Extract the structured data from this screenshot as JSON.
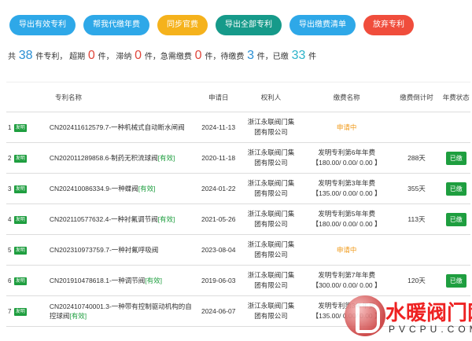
{
  "toolbar": {
    "export_valid": "导出有效专利",
    "pay_annual": "帮我代缴年费",
    "sync_official": "同步官费",
    "export_all": "导出全部专利",
    "export_fees": "导出缴费清单",
    "abandon": "放弃专利"
  },
  "summary": {
    "prefix": "共",
    "total": "38",
    "t1": "件专利，  超期",
    "overdue": "0",
    "t2": "件，  滞纳",
    "late": "0",
    "t3": "件，急需缴费",
    "urgent": "0",
    "t4": "件，待缴费",
    "pending": "3",
    "t5": "件，已缴",
    "paid": "33",
    "t6": "件"
  },
  "table": {
    "headers": {
      "name": "专利名称",
      "date": "申请日",
      "owner": "权利人",
      "fee": "缴费名称",
      "countdown": "缴费倒计时",
      "status": "年费状态"
    },
    "rows": [
      {
        "idx": "1",
        "tag": "发明",
        "name": "CN202411612579.7-一种机械式自动断水闸阀",
        "valid": "",
        "date": "2024-11-13",
        "owner1": "浙江永联阀门集",
        "owner2": "团有限公司",
        "fee1": "申请中",
        "fee2": "",
        "days": "",
        "status": ""
      },
      {
        "idx": "2",
        "tag": "发明",
        "name": "CN202011289858.6-制药无积流球阀",
        "valid": "[有效]",
        "date": "2020-11-18",
        "owner1": "浙江永联阀门集",
        "owner2": "团有限公司",
        "fee1": "发明专利第6年年费",
        "fee2": "【180.00/ 0.00/ 0.00 】",
        "days": "288天",
        "status": "已缴"
      },
      {
        "idx": "3",
        "tag": "发明",
        "name": "CN202410086334.9-一种蝶阀",
        "valid": "[有效]",
        "date": "2024-01-22",
        "owner1": "浙江永联阀门集",
        "owner2": "团有限公司",
        "fee1": "发明专利第3年年费",
        "fee2": "【135.00/ 0.00/ 0.00 】",
        "days": "355天",
        "status": "已缴"
      },
      {
        "idx": "4",
        "tag": "发明",
        "name": "CN202110577632.4-一种衬氟调节阀",
        "valid": "[有效]",
        "date": "2021-05-26",
        "owner1": "浙江永联阀门集",
        "owner2": "团有限公司",
        "fee1": "发明专利第5年年费",
        "fee2": "【180.00/ 0.00/ 0.00 】",
        "days": "113天",
        "status": "已缴"
      },
      {
        "idx": "5",
        "tag": "发明",
        "name": "CN202310973759.7-一种衬氟呼吸阀",
        "valid": "",
        "date": "2023-08-04",
        "owner1": "浙江永联阀门集",
        "owner2": "团有限公司",
        "fee1": "申请中",
        "fee2": "",
        "days": "",
        "status": ""
      },
      {
        "idx": "6",
        "tag": "发明",
        "name": "CN201910478618.1-一种调节阀",
        "valid": "[有效]",
        "date": "2019-06-03",
        "owner1": "浙江永联阀门集",
        "owner2": "团有限公司",
        "fee1": "发明专利第7年年费",
        "fee2": "【300.00/ 0.00/ 0.00 】",
        "days": "120天",
        "status": "已缴"
      },
      {
        "idx": "7",
        "tag": "发明",
        "name": "CN202410740001.3-一种带有控制驱动机构的自控球阀",
        "valid": "[有效]",
        "date": "2024-06-07",
        "owner1": "浙江永联阀门集",
        "owner2": "团有限公司",
        "fee1": "发明专利第3年年费",
        "fee2": "【135.00/ 0.00/ 0.00 】",
        "days": "",
        "status": ""
      }
    ]
  },
  "watermark": {
    "text": "水暖阀门网",
    "url": "PVCPU.COM"
  }
}
